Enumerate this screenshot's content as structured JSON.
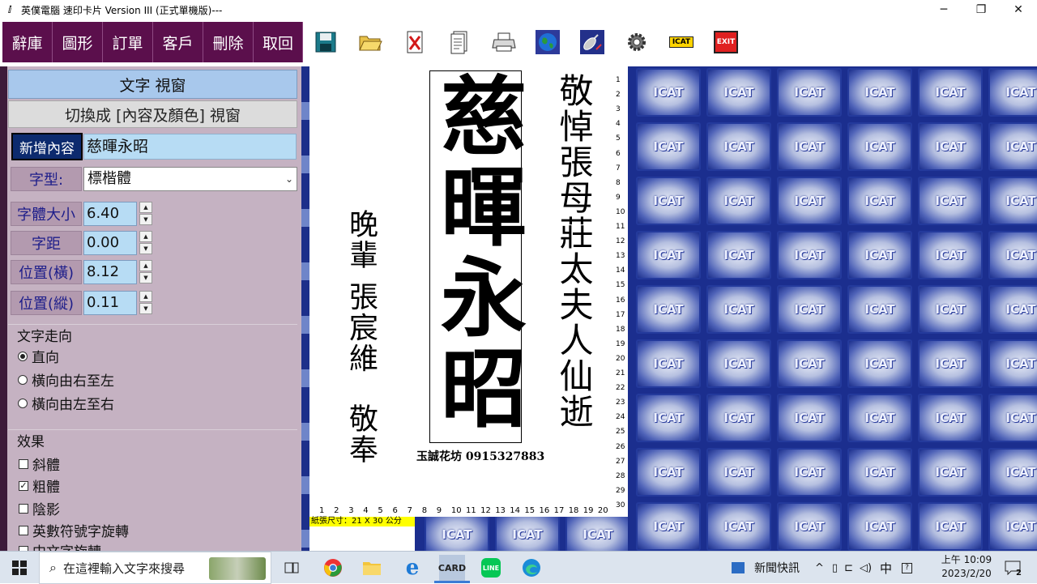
{
  "window": {
    "title": "英僕電腦 速印卡片 Version III (正式單機版)---",
    "app_icon": "card-app-icon",
    "minimize": "─",
    "maximize": "❐",
    "close": "✕"
  },
  "menu": {
    "items": [
      "辭庫",
      "圖形",
      "訂單",
      "客戶",
      "刪除",
      "取回"
    ]
  },
  "toolbar": {
    "icons": [
      "save-icon",
      "open-folder-icon",
      "delete-file-icon",
      "document-icon",
      "printer-icon",
      "globe-icon",
      "satellite-icon",
      "settings-icon",
      "icat-logo-icon",
      "exit-icon"
    ],
    "icat_label": "ICAT",
    "exit_label": "EXIT"
  },
  "panel": {
    "title": "文字 視窗",
    "switch_label": "切換成 [內容及顏色] 視窗",
    "add_button": "新增內容",
    "content_value": "慈暉永昭",
    "font_label": "字型:",
    "font_value": "標楷體",
    "size_label": "字體大小",
    "size_value": "6.40",
    "spacing_label": "字距",
    "spacing_value": "0.00",
    "pos_x_label": "位置(橫)",
    "pos_x_value": "8.12",
    "pos_y_label": "位置(縱)",
    "pos_y_value": "0.11",
    "direction": {
      "title": "文字走向",
      "options": [
        "直向",
        "橫向由右至左",
        "橫向由左至右"
      ],
      "selected": "直向"
    },
    "effects": {
      "title": "效果",
      "options": [
        {
          "label": "斜體",
          "checked": false
        },
        {
          "label": "粗體",
          "checked": true
        },
        {
          "label": "陰影",
          "checked": false
        },
        {
          "label": "英數符號字旋轉",
          "checked": false
        },
        {
          "label": "中文字旋轉",
          "checked": false
        }
      ]
    }
  },
  "card": {
    "right_text": "敬悼張母莊太夫人仙逝",
    "main_text": "慈暉永昭",
    "left_text_1": "晚輩 張宸維",
    "left_text_2": "敬奉",
    "shop_line": "玉誠花坊 0915327883"
  },
  "rulers": {
    "vertical": [
      "1",
      "2",
      "3",
      "4",
      "5",
      "6",
      "7",
      "8",
      "9",
      "10",
      "11",
      "12",
      "13",
      "14",
      "15",
      "16",
      "17",
      "18",
      "19",
      "20",
      "21",
      "22",
      "23",
      "24",
      "25",
      "26",
      "27",
      "28",
      "29",
      "30"
    ],
    "horizontal": [
      "1",
      "2",
      "3",
      "4",
      "5",
      "6",
      "7",
      "8",
      "9",
      "10",
      "11",
      "12",
      "13",
      "14",
      "15",
      "16",
      "17",
      "18",
      "19",
      "20"
    ],
    "paper_size": "紙張尺寸：21 X 30 公分"
  },
  "tile_label": "ICAT",
  "taskbar": {
    "search_placeholder": "在這裡輸入文字來搜尋",
    "apps": [
      "task-view-icon",
      "chrome-icon",
      "file-explorer-icon",
      "internet-explorer-icon",
      "card-app-icon",
      "line-icon",
      "edge-icon"
    ],
    "news": "新聞快訊",
    "ime": "中",
    "time": "上午 10:09",
    "date": "2023/2/20",
    "notifications": "2"
  }
}
